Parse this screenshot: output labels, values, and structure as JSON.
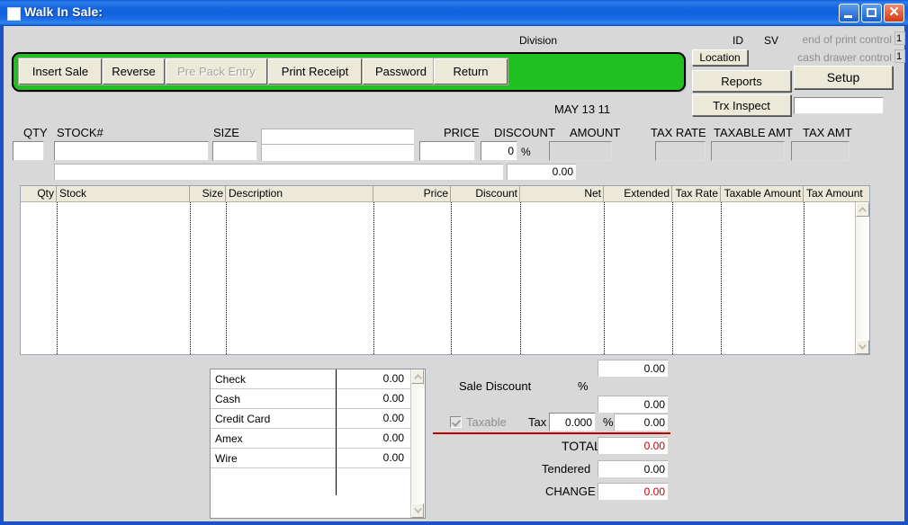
{
  "window": {
    "title": "Walk In Sale:",
    "icon": "app-window-icon",
    "minimize_label": "Minimize",
    "maximize_label": "Maximize",
    "close_label": "Close"
  },
  "toolbar": {
    "buttons": [
      {
        "label": "Insert Sale",
        "disabled": false
      },
      {
        "label": "Reverse",
        "disabled": false
      },
      {
        "label": "Pre Pack Entry",
        "disabled": true
      },
      {
        "label": "Print Receipt",
        "disabled": false
      },
      {
        "label": "Password",
        "disabled": false
      },
      {
        "label": "Return",
        "disabled": false
      }
    ],
    "green_panel_color": "#21c021"
  },
  "header": {
    "division_label": "Division",
    "division_value": "",
    "date_text": "MAY 13 11",
    "id_label": "ID",
    "sv_label": "SV",
    "location_button": "Location",
    "reports_button": "Reports",
    "trx_inspect_button": "Trx Inspect",
    "setup_button": "Setup",
    "end_of_print_control_label": "end of print control",
    "end_of_print_control_value": "1",
    "cash_drawer_control_label": "cash drawer control",
    "cash_drawer_control_value": "1",
    "setup_field_value": ""
  },
  "entry": {
    "qty_label": "QTY",
    "qty_value": "",
    "stock_label": "STOCK#",
    "stock_value": "",
    "size_label": "SIZE",
    "size_value": "",
    "description_top_value": "",
    "description_value": "",
    "price_label": "PRICE",
    "price_value": "",
    "discount_label": "DISCOUNT",
    "discount_value": "0",
    "discount_pct": "%",
    "amount_label": "AMOUNT",
    "amount_value": "",
    "tax_rate_label": "TAX RATE",
    "tax_rate_value": "",
    "taxable_amt_label": "TAXABLE AMT",
    "taxable_amt_value": "",
    "tax_amt_label": "TAX AMT",
    "tax_amt_value": "",
    "long_desc_value": "",
    "row2_amount": "0.00"
  },
  "grid": {
    "columns": [
      {
        "key": "qty",
        "label": "Qty",
        "align": "r"
      },
      {
        "key": "stock",
        "label": "Stock",
        "align": "l"
      },
      {
        "key": "size",
        "label": "Size",
        "align": "r"
      },
      {
        "key": "description",
        "label": "Description",
        "align": "l"
      },
      {
        "key": "price",
        "label": "Price",
        "align": "r"
      },
      {
        "key": "discount",
        "label": "Discount",
        "align": "r"
      },
      {
        "key": "net",
        "label": "Net",
        "align": "r"
      },
      {
        "key": "extended",
        "label": "Extended",
        "align": "r"
      },
      {
        "key": "tax_rate",
        "label": "Tax Rate",
        "align": "r"
      },
      {
        "key": "taxable_amount",
        "label": "Taxable Amount",
        "align": "r"
      },
      {
        "key": "tax_amount",
        "label": "Tax Amount",
        "align": "l"
      }
    ],
    "rows": []
  },
  "payments": {
    "rows": [
      {
        "name": "Check",
        "amount": "0.00"
      },
      {
        "name": "Cash",
        "amount": "0.00"
      },
      {
        "name": "Credit Card",
        "amount": "0.00"
      },
      {
        "name": "Amex",
        "amount": "0.00"
      },
      {
        "name": "Wire",
        "amount": "0.00"
      },
      {
        "name": "",
        "amount": ""
      }
    ]
  },
  "totals": {
    "subtotal_value": "0.00",
    "sale_discount_label": "Sale Discount",
    "sale_discount_pct": "%",
    "after_discount_value": "0.00",
    "taxable_label": "Taxable",
    "taxable_checked": true,
    "tax_label": "Tax",
    "tax_rate_value": "0.000",
    "tax_pct": "%",
    "tax_amount_value": "0.00",
    "total_label": "TOTAL",
    "total_value": "0.00",
    "tendered_label": "Tendered",
    "tendered_value": "0.00",
    "change_label": "CHANGE",
    "change_value": "0.00",
    "total_color": "#c00000",
    "divider_color": "#c00000"
  }
}
